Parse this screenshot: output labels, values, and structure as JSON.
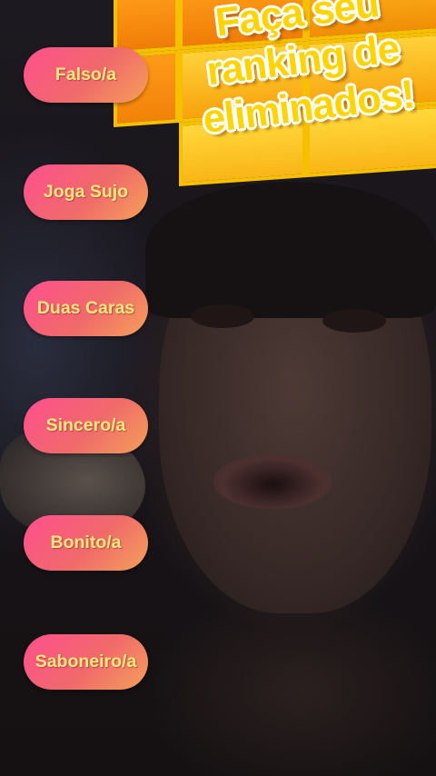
{
  "effect": {
    "title_lines": [
      "Faça seu",
      "ranking de",
      "eliminados!"
    ]
  },
  "labels": [
    {
      "text": "Falso/a"
    },
    {
      "text": "Joga Sujo"
    },
    {
      "text": "Duas Caras"
    },
    {
      "text": "Sincero/a"
    },
    {
      "text": "Bonito/a"
    },
    {
      "text": "Saboneiro/a"
    }
  ],
  "colors": {
    "pill_gradient_start": "#ff4f8e",
    "pill_gradient_end": "#f5a05a",
    "pill_text": "#ffe97a",
    "title_fill": "#ffd400",
    "board_orange": "#ef7d06",
    "board_yellow": "#ffd23a"
  }
}
